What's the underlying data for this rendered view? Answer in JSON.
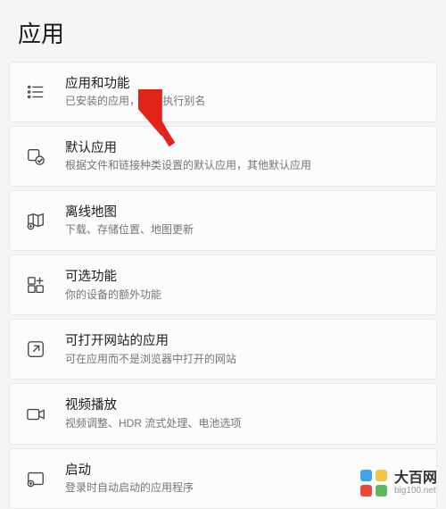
{
  "page_title": "应用",
  "items": [
    {
      "title": "应用和功能",
      "desc_part1": "已安装的应用，",
      "desc_part2": "用执行别名"
    },
    {
      "title": "默认应用",
      "desc": "根据文件和链接种类设置的默认应用，其他默认应用"
    },
    {
      "title": "离线地图",
      "desc": "下载、存储位置、地图更新"
    },
    {
      "title": "可选功能",
      "desc": "你的设备的额外功能"
    },
    {
      "title": "可打开网站的应用",
      "desc": "可在应用而不是浏览器中打开的网站"
    },
    {
      "title": "视频播放",
      "desc": "视频调整、HDR 流式处理、电池选项"
    },
    {
      "title": "启动",
      "desc": "登录时自动启动的应用程序"
    }
  ],
  "watermark": {
    "name": "大百网",
    "url": "big100.net"
  }
}
